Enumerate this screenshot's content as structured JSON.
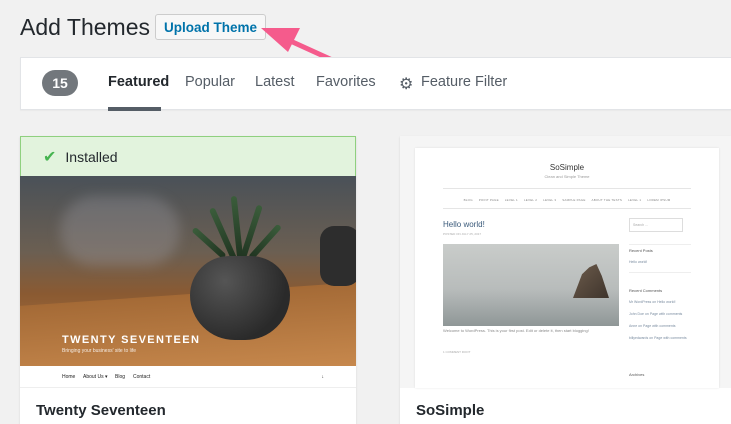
{
  "page": {
    "title": "Add Themes",
    "upload_button": "Upload Theme"
  },
  "filter_bar": {
    "count": "15",
    "tabs": [
      {
        "label": "Featured",
        "active": true
      },
      {
        "label": "Popular",
        "active": false
      },
      {
        "label": "Latest",
        "active": false
      },
      {
        "label": "Favorites",
        "active": false
      }
    ],
    "feature_filter_label": "Feature Filter",
    "feature_filter_icon": "gear-icon"
  },
  "annotation": {
    "arrow_color": "#f55b8c"
  },
  "themes": [
    {
      "name": "Twenty Seventeen",
      "installed": true,
      "installed_label": "Installed",
      "installed_icon": "checkmark-icon",
      "screenshot": {
        "site_title": "TWENTY SEVENTEEN",
        "tagline": "Bringing your business' site to life",
        "nav": [
          "Home",
          "About Us ▾",
          "Blog",
          "Contact"
        ],
        "nav_arrow": "↓"
      }
    },
    {
      "name": "SoSimple",
      "installed": false,
      "screenshot": {
        "site_title": "SoSimple",
        "tagline": "Clean and Simple Theme",
        "menu": [
          "BLOG",
          "POINT PAGE",
          "LEVEL 1",
          "LEVEL 2",
          "LEVEL 3",
          "SAMPLE PAGE",
          "ABOUT THE TESTS",
          "LEVEL 1",
          "LOREM IPSUM"
        ],
        "post_title": "Hello world!",
        "post_meta": "POSTED ON JULY 25, 2017",
        "post_body": "Welcome to WordPress. This is your first post. Edit or delete it, then start blogging!",
        "post_more": "1 COMMENT ROOT",
        "search_placeholder": "Search ...",
        "sidebar": {
          "recent_posts_heading": "Recent Posts",
          "recent_posts": [
            "Hello world!"
          ],
          "recent_comments_heading": "Recent Comments",
          "recent_comments": [
            "Mr WordPress on Hello world!",
            "John Doe on Page with comments",
            "Anne on Page with comments",
            "billyedwards on Page with comments"
          ],
          "archives_heading": "Archives"
        }
      }
    }
  ]
}
